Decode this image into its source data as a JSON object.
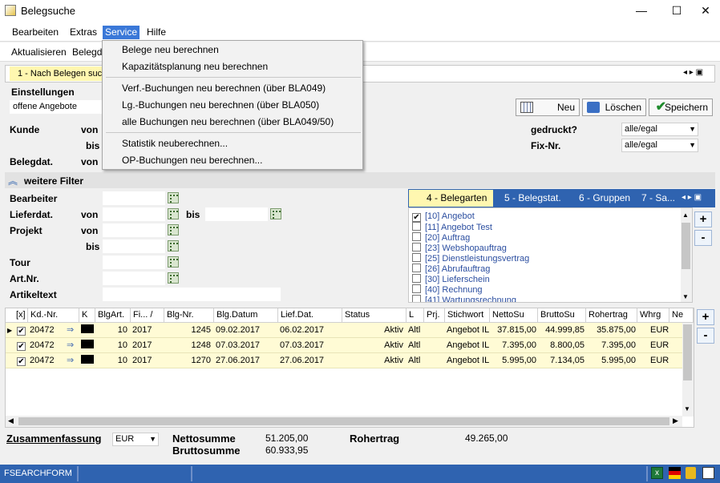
{
  "window": {
    "title": "Belegsuche",
    "min": "—",
    "max": "☐",
    "close": "✕"
  },
  "menubar": {
    "items": [
      "Bearbeiten",
      "Extras",
      "Service",
      "Hilfe"
    ]
  },
  "toolbar": {
    "items": [
      "Aktualisieren",
      "Belegd"
    ]
  },
  "tabs": {
    "active": "1 - Nach Belegen suc"
  },
  "settings": {
    "label": "Einstellungen",
    "value": "offene Angebote"
  },
  "buttons": {
    "new": "Neu",
    "delete": "Löschen",
    "save": "Speichern"
  },
  "fields": {
    "kunde": "Kunde",
    "von": "von",
    "bis": "bis",
    "belegdat": "Belegdat.",
    "gedruckt": "gedruckt?",
    "gedruckt_value": "alle/egal",
    "fixnr": "Fix-Nr.",
    "fixnr_value": "alle/egal"
  },
  "filters": {
    "header": "weitere Filter",
    "bearbeiter": "Bearbeiter",
    "lieferdat": "Lieferdat.",
    "von": "von",
    "bis": "bis",
    "projekt": "Projekt",
    "tour": "Tour",
    "artnr": "Art.Nr.",
    "artikeltext": "Artikeltext"
  },
  "beleg_tabs": [
    "4 - Belegarten",
    "5 - Belegstat.",
    "6 - Gruppen",
    "7 - Sa..."
  ],
  "belegarten": [
    {
      "label": "[10] Angebot",
      "checked": true
    },
    {
      "label": "[11] Angebot Test",
      "checked": false
    },
    {
      "label": "[20] Auftrag",
      "checked": false
    },
    {
      "label": "[23] Webshopauftrag",
      "checked": false
    },
    {
      "label": "[25] Dienstleistungsvertrag",
      "checked": false
    },
    {
      "label": "[26] Abrufauftrag",
      "checked": false
    },
    {
      "label": "[30] Lieferschein",
      "checked": false
    },
    {
      "label": "[40] Rechnung",
      "checked": false
    },
    {
      "label": "[41] Wartungsrechnung",
      "checked": false
    }
  ],
  "grid": {
    "headers": [
      "[x]",
      "Kd.-Nr.",
      "K",
      "BlgArt.",
      "Fi...",
      "Blg-Nr.",
      "Blg.Datum",
      "Lief.Dat.",
      "Status",
      "L",
      "Prj.",
      "Stichwort",
      "NettoSu",
      "BruttoSu",
      "Rohertrag",
      "Whrg",
      "Ne"
    ],
    "rows": [
      [
        "20472",
        "10",
        "2017",
        "1245",
        "09.02.2017",
        "06.02.2017",
        "Aktiv",
        "Altl",
        "Angebot IL",
        "37.815,00",
        "44.999,85",
        "35.875,00",
        "EUR"
      ],
      [
        "20472",
        "10",
        "2017",
        "1248",
        "07.03.2017",
        "07.03.2017",
        "Aktiv",
        "Altl",
        "Angebot IL",
        "7.395,00",
        "8.800,05",
        "7.395,00",
        "EUR"
      ],
      [
        "20472",
        "10",
        "2017",
        "1270",
        "27.06.2017",
        "27.06.2017",
        "Aktiv",
        "Altl",
        "Angebot IL",
        "5.995,00",
        "7.134,05",
        "5.995,00",
        "EUR"
      ]
    ]
  },
  "summary": {
    "label": "Zusammenfassung",
    "currency": "EUR",
    "netto_label": "Nettosumme",
    "netto": "51.205,00",
    "brutto_label": "Bruttosumme",
    "brutto": "60.933,95",
    "roh_label": "Rohertrag",
    "roh": "49.265,00"
  },
  "statusbar": {
    "form": "FSEARCHFORM"
  },
  "service_menu": {
    "items": [
      "Belege neu berechnen",
      "Kapazitätsplanung neu berechnen",
      "Verf.-Buchungen neu berechnen (über BLA049)",
      "Lg.-Buchungen neu berechnen (über BLA050)",
      "alle Buchungen neu berechnen (über BLA049/50)",
      "Statistik neuberechnen...",
      "OP-Buchungen neu berechnen..."
    ]
  },
  "colors": {
    "accent": "#2f63b0",
    "highlight": "#fff7b0",
    "menu_active": "#3a78d8"
  }
}
